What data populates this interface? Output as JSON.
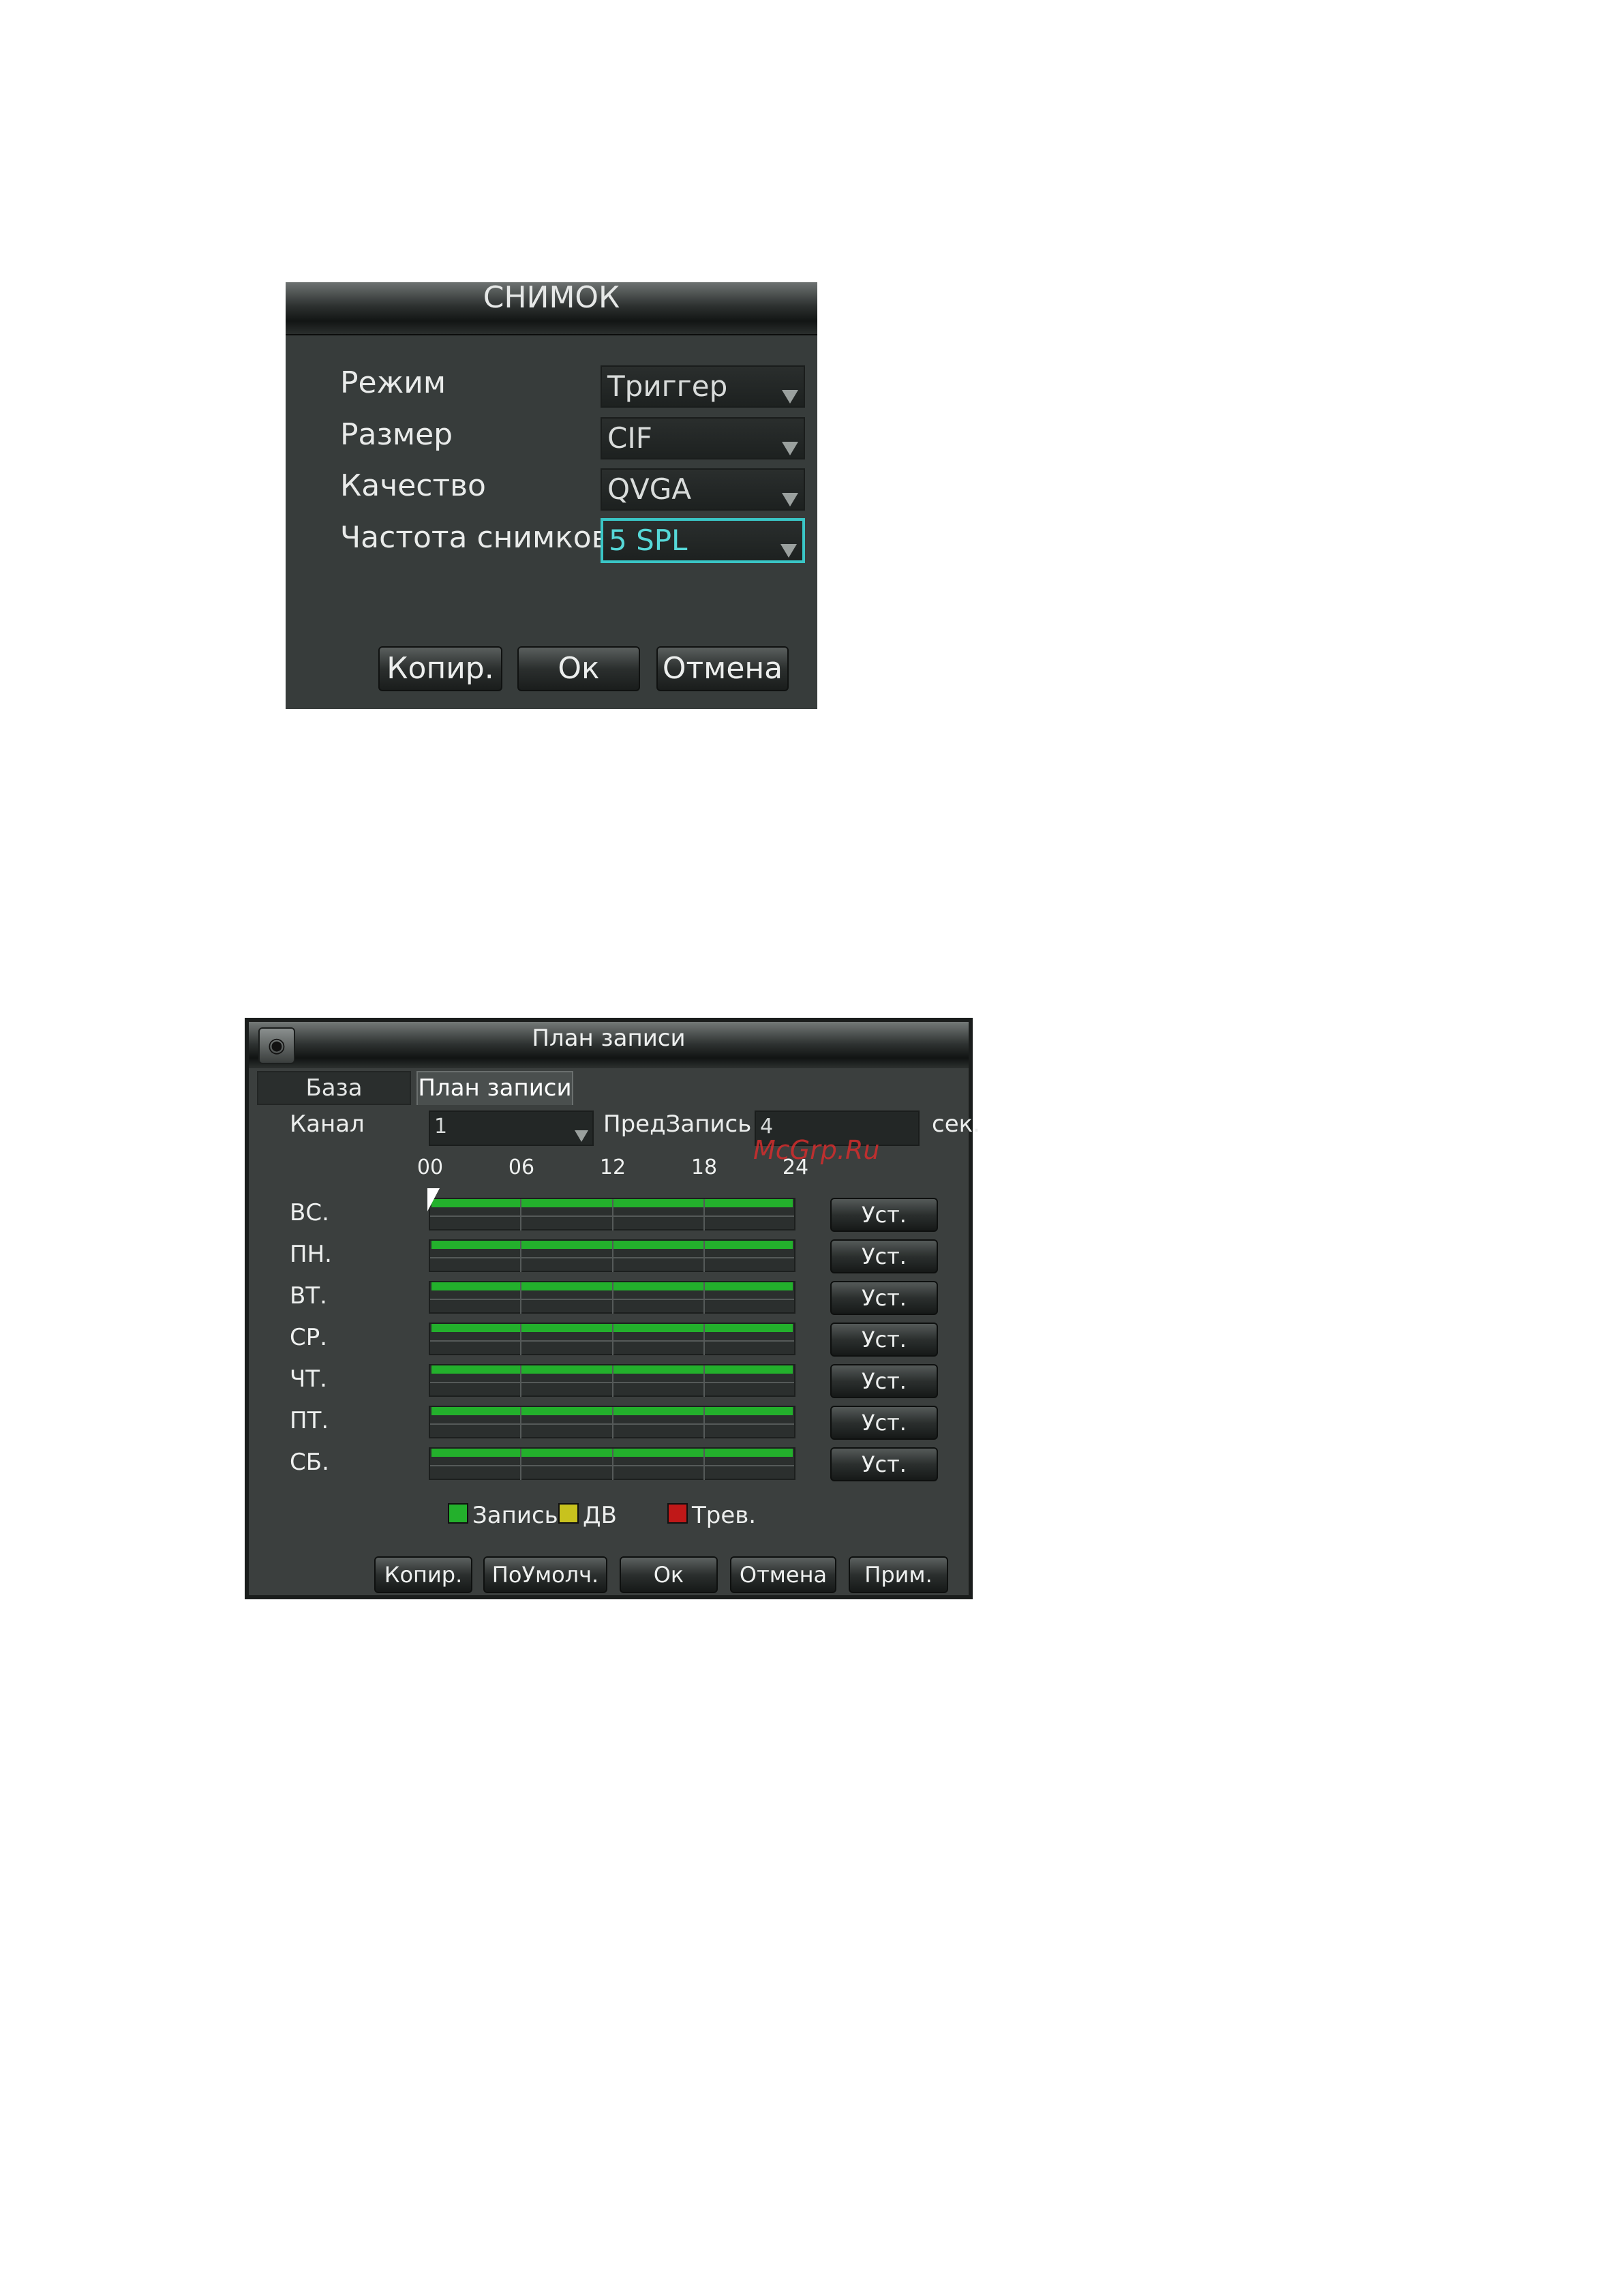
{
  "snapshot": {
    "title": "СНИМОК",
    "fields": [
      {
        "label": "Режим",
        "value": "Триггер"
      },
      {
        "label": "Размер",
        "value": "CIF"
      },
      {
        "label": "Качество",
        "value": "QVGA"
      },
      {
        "label": "Частота снимков",
        "value": "5 SPL"
      }
    ],
    "buttons": {
      "copy": "Копир.",
      "ok": "Ок",
      "cancel": "Отмена"
    }
  },
  "plan": {
    "title": "План записи",
    "icon": "camera-icon",
    "tabs": [
      "База",
      "План записи"
    ],
    "channel_label": "Канал",
    "channel_value": "1",
    "prerecord_label": "ПредЗапись",
    "prerecord_value": "4",
    "prerecord_unit": "сек.",
    "watermark": "McGrp.Ru",
    "hours": [
      "00",
      "06",
      "12",
      "18",
      "24"
    ],
    "days": [
      "ВС.",
      "ПН.",
      "ВТ.",
      "СР.",
      "ЧТ.",
      "ПТ.",
      "СБ."
    ],
    "set_label": "Уст.",
    "legend": [
      {
        "label": "Запись",
        "color": "#23b02c"
      },
      {
        "label": "ДВ",
        "color": "#c8c21e"
      },
      {
        "label": "Трев.",
        "color": "#c01818"
      }
    ],
    "buttons": {
      "copy": "Копир.",
      "default": "ПоУмолч.",
      "ok": "Ок",
      "cancel": "Отмена",
      "apply": "Прим."
    }
  }
}
